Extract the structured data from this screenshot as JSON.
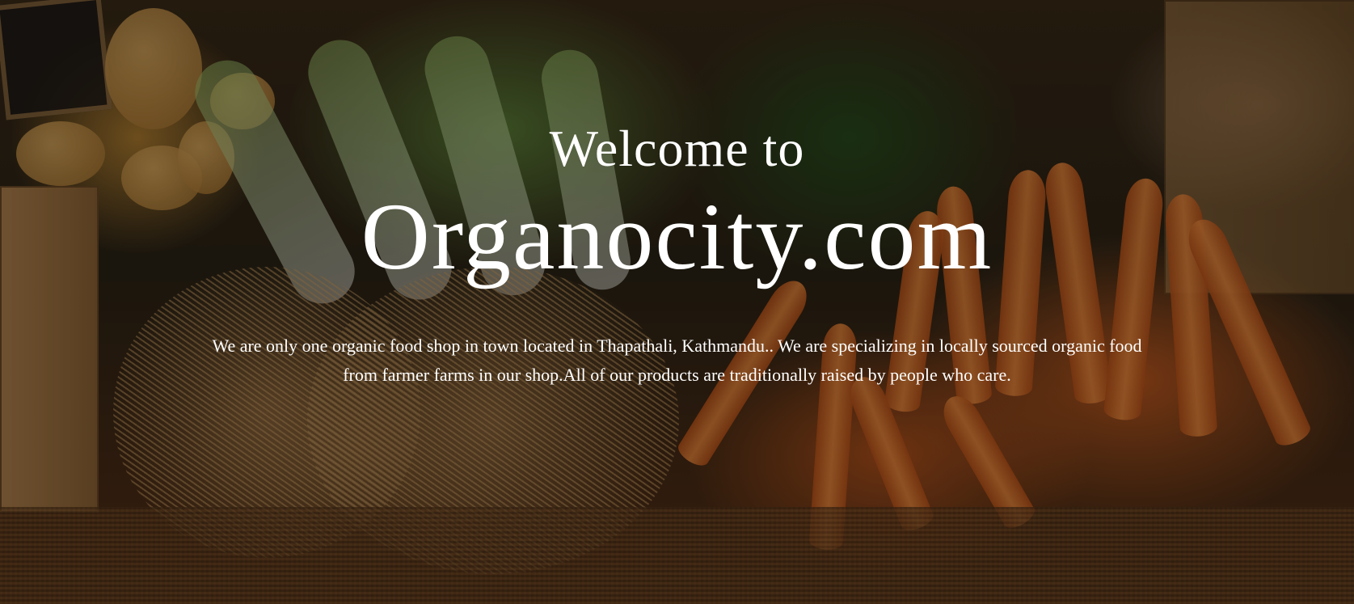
{
  "hero": {
    "welcome": "Welcome to",
    "brand": "Organocity.com",
    "description": "We are  only one organic food shop in town located in Thapathali, Kathmandu.. We are specializing in locally sourced organic food from farmer farms in our shop.All of  our products are traditionally raised by people who care.",
    "background_image": "fresh-produce-photo",
    "text_color": "#ffffff"
  }
}
